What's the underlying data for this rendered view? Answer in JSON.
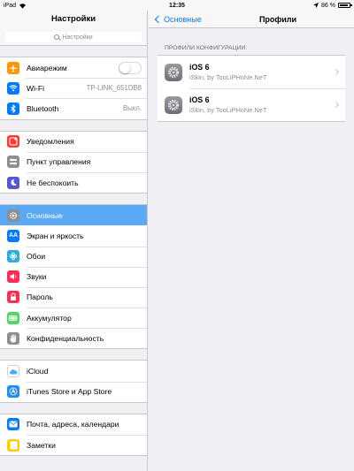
{
  "statusbar": {
    "device": "iPad",
    "time": "12:35",
    "battery": "86 %"
  },
  "master": {
    "title": "Настройки",
    "search_placeholder": "Настройки",
    "groups": [
      [
        {
          "label": "Авиарежим",
          "icon": "airplane-icon",
          "color": "#ff9500"
        },
        {
          "label": "Wi-Fi",
          "value": "TP-LINK_651DB8",
          "icon": "wifi-icon",
          "color": "#007aff"
        },
        {
          "label": "Bluetooth",
          "value": "Выкл.",
          "icon": "bluetooth-icon",
          "color": "#007aff"
        }
      ],
      [
        {
          "label": "Уведомления",
          "icon": "notifications-icon",
          "color": "#ff3b30"
        },
        {
          "label": "Пункт управления",
          "icon": "control-center-icon",
          "color": "#8e8e93"
        },
        {
          "label": "Не беспокоить",
          "icon": "moon-icon",
          "color": "#5856d6"
        }
      ],
      [
        {
          "label": "Основные",
          "icon": "gear-icon",
          "color": "#8e8e93"
        },
        {
          "label": "Экран и яркость",
          "icon": "text-size-icon",
          "color": "#007aff"
        },
        {
          "label": "Обои",
          "icon": "wallpaper-icon",
          "color": "#34aadc"
        },
        {
          "label": "Звуки",
          "icon": "speaker-icon",
          "color": "#ff2d55"
        },
        {
          "label": "Пароль",
          "icon": "lock-icon",
          "color": "#ff2d55"
        },
        {
          "label": "Аккумулятор",
          "icon": "battery-icon",
          "color": "#4cd964"
        },
        {
          "label": "Конфиденциальность",
          "icon": "hand-icon",
          "color": "#8e8e93"
        }
      ],
      [
        {
          "label": "iCloud",
          "icon": "cloud-icon",
          "color": "#ffffff"
        },
        {
          "label": "iTunes Store и App Store",
          "icon": "app-store-icon",
          "color": "#1e8cf0"
        }
      ],
      [
        {
          "label": "Почта, адреса, календари",
          "icon": "mail-icon",
          "color": "#007aff"
        },
        {
          "label": "Заметки",
          "icon": "notes-icon",
          "color": "#ffcc00"
        }
      ]
    ]
  },
  "detail": {
    "back_label": "Основные",
    "title": "Профили",
    "section_title": "ПРОФИЛИ КОНФИГУРАЦИИ",
    "profiles": [
      {
        "name": "iOS 6",
        "subtitle": "iSkin, by TooLiPHoNe.NeT"
      },
      {
        "name": "iOS 6",
        "subtitle": "iSkin, by TooLiPHoNe.NeT"
      }
    ]
  }
}
